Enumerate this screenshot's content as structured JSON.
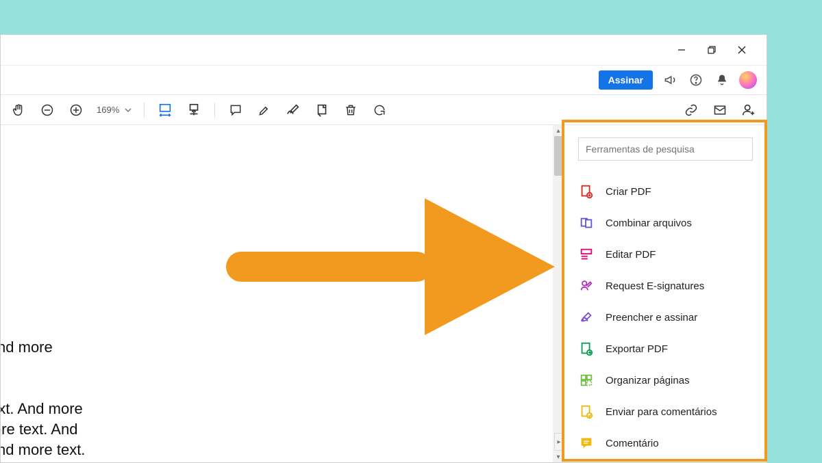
{
  "window_controls": {
    "minimize": "—",
    "restore": "▭",
    "close": "✕"
  },
  "ribbon": {
    "sign_label": "Assinar"
  },
  "toolbar": {
    "zoom_value": "169%"
  },
  "document": {
    "line1": "ext. And more",
    "line2": "ore text. And more",
    "line3": "nd more text. And",
    "line4": "ext. And more text."
  },
  "tools_panel": {
    "search_placeholder": "Ferramentas de pesquisa",
    "items": [
      {
        "label": "Criar PDF",
        "color": "#e1251b",
        "icon": "create-pdf-icon"
      },
      {
        "label": "Combinar arquivos",
        "color": "#6256c9",
        "icon": "combine-files-icon"
      },
      {
        "label": "Editar PDF",
        "color": "#e5007d",
        "icon": "edit-pdf-icon"
      },
      {
        "label": "Request E-signatures",
        "color": "#b130bd",
        "icon": "request-signature-icon"
      },
      {
        "label": "Preencher e assinar",
        "color": "#7e4ed9",
        "icon": "fill-sign-icon"
      },
      {
        "label": "Exportar PDF",
        "color": "#0b9c57",
        "icon": "export-pdf-icon"
      },
      {
        "label": "Organizar páginas",
        "color": "#72bf44",
        "icon": "organize-pages-icon"
      },
      {
        "label": "Enviar para comentários",
        "color": "#f2b90c",
        "icon": "send-comments-icon"
      },
      {
        "label": "Comentário",
        "color": "#f2b90c",
        "icon": "comment-icon"
      }
    ]
  },
  "colors": {
    "accent_orange": "#f29a1f"
  }
}
